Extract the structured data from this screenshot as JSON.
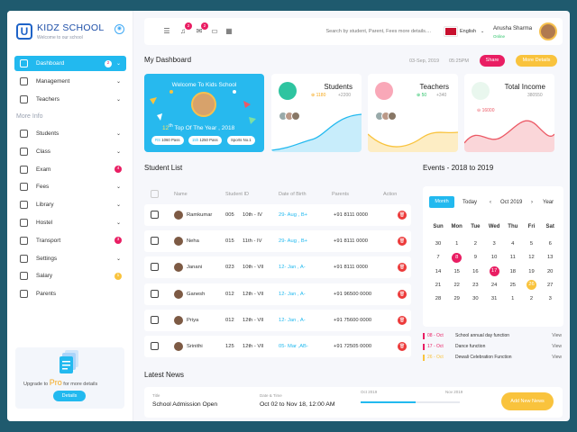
{
  "sidebar": {
    "brand": "KIDZ SCHOOL",
    "tagline": "Welcome to our school",
    "logo_letter": "U",
    "menu": [
      {
        "label": "Dashboard",
        "badge": "2",
        "active": true,
        "chevron": true
      },
      {
        "label": "Management",
        "chevron": true
      },
      {
        "label": "Teachers",
        "chevron": true
      }
    ],
    "more_info_title": "More Info",
    "more": [
      {
        "label": "Students",
        "chevron": true
      },
      {
        "label": "Class",
        "chevron": true
      },
      {
        "label": "Exam",
        "badge": "4",
        "badge_color": "#e91e63"
      },
      {
        "label": "Fees",
        "chevron": true
      },
      {
        "label": "Library",
        "chevron": true
      },
      {
        "label": "Hostel",
        "chevron": true
      },
      {
        "label": "Transport",
        "badge": "3",
        "badge_color": "#e91e63"
      },
      {
        "label": "Settings",
        "chevron": true
      },
      {
        "label": "Salary",
        "badge": "1",
        "badge_color": "#f9c33d"
      },
      {
        "label": "Parents"
      }
    ],
    "promo": {
      "prefix": "Upgrade to",
      "pro": "Pro",
      "suffix": "for more details",
      "button": "Details"
    }
  },
  "topbar": {
    "badges": {
      "notifications": "2",
      "mail": "2"
    },
    "search_placeholder": "Search by student, Parent, Fees more details....",
    "language": "English",
    "user_name": "Anusha Sharma",
    "user_status": "Online"
  },
  "dashboard": {
    "title": "My Dashboard",
    "date": "03-Sep, 2019",
    "time": "05:25PM",
    "share": "Share",
    "more_details": "More Details",
    "welcome": {
      "title": "Welcome To Kids School",
      "rank_num": "12",
      "rank_sup": "th",
      "rank_text": "Top Of The Year , 2018",
      "chips": [
        {
          "k": "RS",
          "v": "1060 Pass"
        },
        {
          "k": "15h",
          "v": "1250 Pass"
        },
        {
          "k": "",
          "v": "Sports No.1"
        }
      ]
    },
    "stats": [
      {
        "title": "Students",
        "up": "1180",
        "plus": "+2200",
        "color": "#22b9ef"
      },
      {
        "title": "Teachers",
        "up": "50",
        "plus": "+340",
        "color": "#f9c33d"
      },
      {
        "title": "Total Income",
        "up": "",
        "plus": "380550",
        "down": "16000",
        "color": "#ec5a66"
      }
    ]
  },
  "students": {
    "title": "Student List",
    "headers": [
      "Name",
      "Student ID",
      "Date of Birth",
      "Parents",
      "Action"
    ],
    "rows": [
      {
        "name": "Ramkumar",
        "id": "005",
        "grade": "10th - IV",
        "dob": "29- Aug , B+",
        "phone": "+91 8111 0000"
      },
      {
        "name": "Neha",
        "id": "015",
        "grade": "11th - IV",
        "dob": "29- Aug , B+",
        "phone": "+91 8111 0000"
      },
      {
        "name": "Janani",
        "id": "023",
        "grade": "10th - VII",
        "dob": "12- Jan , A-",
        "phone": "+91 8111 0000"
      },
      {
        "name": "Ganesh",
        "id": "012",
        "grade": "12th - VII",
        "dob": "12- Jan , A-",
        "phone": "+91 96500 0000"
      },
      {
        "name": "Priya",
        "id": "012",
        "grade": "12th - VII",
        "dob": "12- Jan , A-",
        "phone": "+91 75600 0000"
      },
      {
        "name": "Srinithi",
        "id": "125",
        "grade": "12th - VII",
        "dob": "05- Mar ,AB-",
        "phone": "+91 72505 0000"
      }
    ]
  },
  "events": {
    "title": "Events - 2018 to 2019",
    "month_btn": "Month",
    "today": "Today",
    "month": "Oct 2019",
    "year": "Year",
    "day_names": [
      "Sun",
      "Mon",
      "Tue",
      "Wed",
      "Thu",
      "Fri",
      "Sat"
    ],
    "weeks": [
      [
        "30",
        "1",
        "2",
        "3",
        "4",
        "5",
        "6"
      ],
      [
        "7",
        "8",
        "9",
        "10",
        "11",
        "12",
        "13"
      ],
      [
        "14",
        "15",
        "16",
        "17",
        "18",
        "19",
        "20"
      ],
      [
        "21",
        "22",
        "23",
        "24",
        "25",
        "26",
        "27"
      ],
      [
        "28",
        "29",
        "30",
        "31",
        "1",
        "2",
        "3"
      ]
    ],
    "marked": {
      "8": "#e91e63",
      "17": "#e91e63",
      "26": "#f9c33d"
    },
    "list": [
      {
        "date": "08 - Oct",
        "name": "School annual day function",
        "view": "View",
        "color": "#e91e63"
      },
      {
        "date": "17 - Oct",
        "name": "Dance function",
        "view": "View",
        "color": "#e91e63"
      },
      {
        "date": "26 - Oct",
        "name": "Dewali Celebration Function",
        "view": "View",
        "color": "#f9c33d"
      }
    ]
  },
  "news": {
    "title": "Latest News",
    "title_label": "Title",
    "title_value": "School Admission Open",
    "date_label": "Date & Time",
    "date_value": "Oct 02 to Nov 18, 12:00 AM",
    "range_start": "Oct 2019",
    "range_end": "Nov 2019",
    "progress": 0.55,
    "add_button": "Add New News"
  }
}
